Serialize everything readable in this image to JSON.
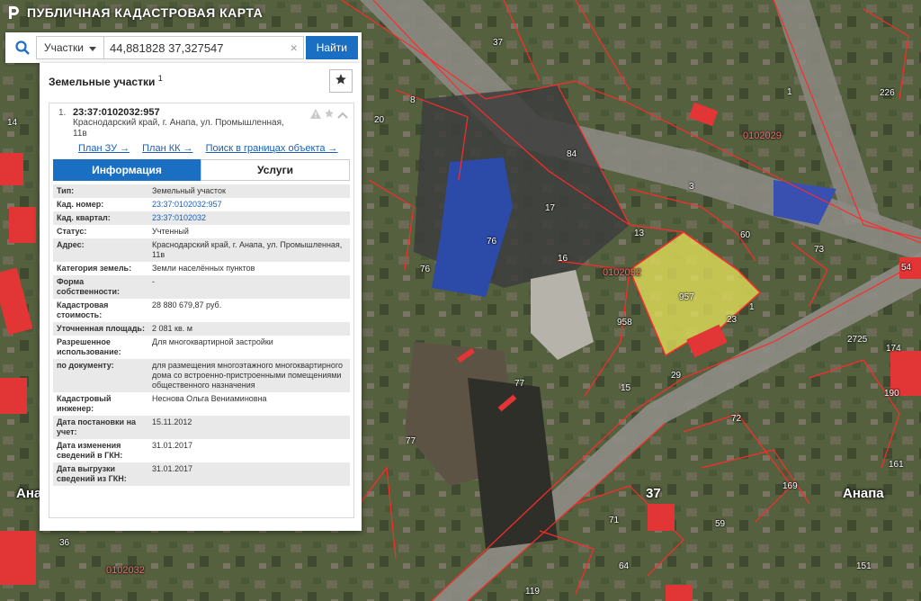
{
  "app": {
    "title": "ПУБЛИЧНАЯ КАДАСТРОВАЯ КАРТА"
  },
  "search": {
    "type_label": "Участки",
    "query": "44,881828 37,327547",
    "find_label": "Найти"
  },
  "panel": {
    "title": "Земельные участки",
    "title_sup": "1",
    "result": {
      "number": "1.",
      "id": "23:37:0102032:957",
      "address": "Краснодарский край, г. Анапа, ул. Промышленная, 11в",
      "links": [
        "План ЗУ →",
        "План КК →",
        "Поиск в границах объекта →"
      ]
    },
    "tabs": [
      "Информация",
      "Услуги"
    ],
    "properties": [
      {
        "key": "Тип:",
        "value": "Земельный участок"
      },
      {
        "key": "Кад. номер:",
        "value": "23:37:0102032:957",
        "link": true
      },
      {
        "key": "Кад. квартал:",
        "value": "23:37:0102032",
        "link": true
      },
      {
        "key": "Статус:",
        "value": "Учтенный"
      },
      {
        "key": "Адрес:",
        "value": "Краснодарский край, г. Анапа, ул. Промышленная, 11в"
      },
      {
        "key": "Категория земель:",
        "value": "Земли населённых пунктов"
      },
      {
        "key": "Форма собственности:",
        "value": "-"
      },
      {
        "key": "Кадастровая стоимость:",
        "value": "28 880 679,87 руб."
      },
      {
        "key": "Уточненная площадь:",
        "value": "2 081 кв. м"
      },
      {
        "key": "Разрешенное использование:",
        "value": "Для многоквартирной застройки"
      },
      {
        "key": "по документу:",
        "value": "для размещения многоэтажного многоквартирного дома со встроенно-пристроенными помещениями общественного назначения"
      },
      {
        "key": "Кадастровый инженер:",
        "value": "Неснова Ольга Вениаминовна"
      },
      {
        "key": "Дата постановки на учет:",
        "value": "15.11.2012"
      },
      {
        "key": "Дата изменения сведений в ГКН:",
        "value": "31.01.2017"
      },
      {
        "key": "Дата выгрузки сведений из ГКН:",
        "value": "31.01.2017"
      }
    ]
  },
  "map": {
    "labels": [
      "37",
      "84",
      "3",
      "60",
      "13",
      "17",
      "16",
      "76",
      "76",
      "73",
      "54",
      "958",
      "957",
      "23",
      "1",
      "15",
      "77",
      "77",
      "72",
      "190",
      "174",
      "2725",
      "161",
      "169",
      "71",
      "64",
      "59",
      "151",
      "119",
      "36",
      "14",
      "226",
      "1",
      "8",
      "20",
      "0102029",
      "0102032",
      "0102032",
      "Анапа",
      "Анапа",
      "37",
      "29"
    ],
    "colors": {
      "boundary": "#ff2a2a",
      "selected_fill": "#e8e65a",
      "accent": "#1a6fc2"
    }
  },
  "icons": [
    "logo-icon",
    "search-icon",
    "chevron-down-icon",
    "close-icon",
    "star-icon",
    "warning-icon",
    "collapse-icon"
  ]
}
